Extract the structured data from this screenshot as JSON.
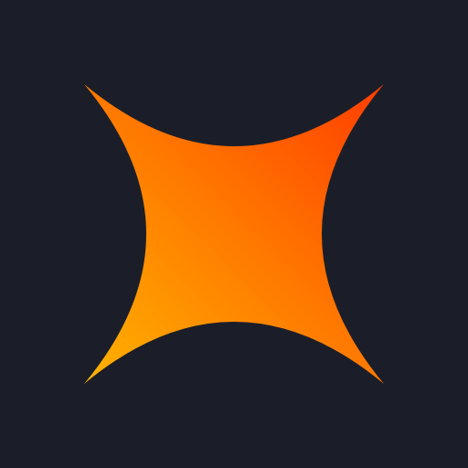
{
  "icon": {
    "name": "four-point-star-icon",
    "background_color": "#1b1e28",
    "gradient": {
      "start_color": "#ffb300",
      "mid_color": "#ff7a00",
      "end_color": "#ff3d00"
    }
  }
}
